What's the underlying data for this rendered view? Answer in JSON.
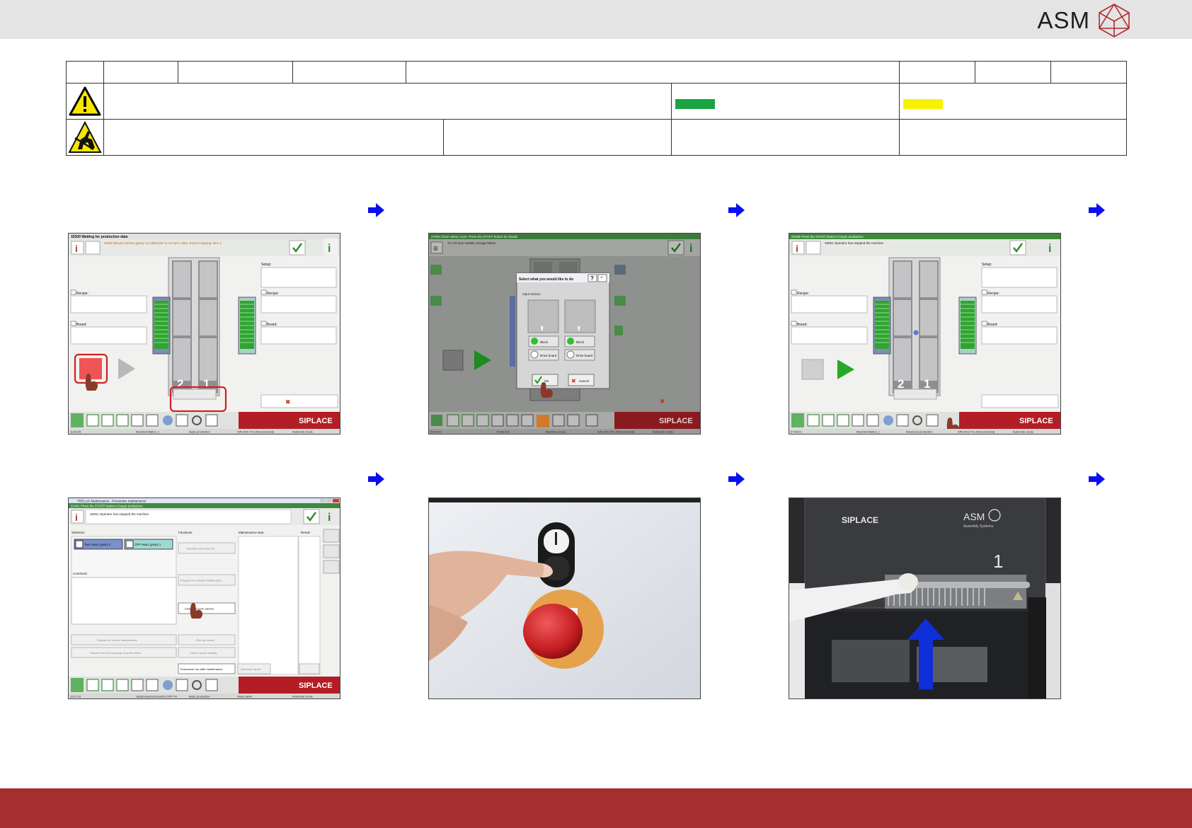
{
  "brand": {
    "logo_text": "ASM"
  },
  "colors": {
    "footer": "#a72e2e",
    "header_bg": "#e4e4e4",
    "swatch_green": "#1aa542",
    "swatch_yellow": "#f6f200",
    "arrow_blue": "#0a10f0",
    "siplace_red": "#b31d25"
  },
  "symbols": [
    "warning-icon",
    "esd-icon",
    "arrow-right-icon"
  ],
  "screens": {
    "s1": {
      "status": "32500 Waiting for production data",
      "message": "32000 [Board camera gantry 1] Calibration is not up to date; Board mapping: lane 2",
      "recipe_label": "Recipe:",
      "board_label": "Board:",
      "setup_label": "Setup:",
      "lane_left": "2",
      "lane_right": "1",
      "brand": "SIPLACE",
      "footer": [
        "11:09:29",
        "Machine\\Station_1",
        "Basic production",
        "SIPLACE Pro (Disconnected)",
        "Automatic mode"
      ]
    },
    "s2": {
      "status": "37000 Close safety cover. Press the START button for details",
      "message": "75 | 04 Non-volatile storage failure",
      "dialog_title": "Select what you would like to do",
      "dialog_section": "Input section",
      "block_label": "Block",
      "drive_label": "Drive board",
      "ok_label": "OK",
      "cancel_label": "Cancel",
      "brand": "SIPLACE",
      "footer": [
        "05:03:22",
        "TCM\\LICD",
        "Machine service",
        "SIPLACE Pro (Disconnected)",
        "Automatic mode"
      ]
    },
    "s3": {
      "status": "21406 Press the START button to begin production",
      "message": "32551 Operator has stopped the machine",
      "recipe_label": "Recipe:",
      "board_label": "Board:",
      "setup_label": "Setup:",
      "lane_left": "2",
      "lane_right": "1",
      "brand": "SIPLACE",
      "footer": [
        "07:08:21",
        "Machine\\Station_1",
        "Advanced production",
        "SIPLACE Pro (Disconnected)",
        "Automatic mode"
      ]
    },
    "s4": {
      "title": "TRELLIS Maintenance - Preventive maintenance",
      "status": "21401 Press the START button to begin production",
      "message": "32551 Operator has stopped the machine",
      "selection_label": "Selection",
      "functions_label": "Functions",
      "step_label": "Maintenance step",
      "result_label": "Result",
      "item1": "Twin Head, gantry 2",
      "item2": "CPP Head, gantry 1",
      "comment_label": "Comment:",
      "btn_ref_run": "Nozzles reference run",
      "btn_prepare_manual": "Prepare for manual maintenance",
      "btn_change_nozzles": "Change nozzle carriers",
      "btn_prepare_nozzle": "Prepare for nozzle maintenance",
      "btn_pickup": "Pick up nozzle",
      "btn_prepare_tool": "Prepare for tool exchange and directions",
      "btn_check_nozzle": "Check nozzle seating",
      "btn_endurance": "Endurance run after maintenance",
      "btn_generate": "Generate report",
      "brand": "SIPLACE",
      "footer": [
        "15:11:41",
        "cap\\Endurance\\runs\\SX.CPP TH",
        "Basic production",
        "Stand alone",
        "Automatic mode"
      ]
    },
    "s6": {
      "brand": "SIPLACE",
      "logo": "ASM",
      "logo_sub": "Assembly Systems",
      "number": "1"
    }
  }
}
